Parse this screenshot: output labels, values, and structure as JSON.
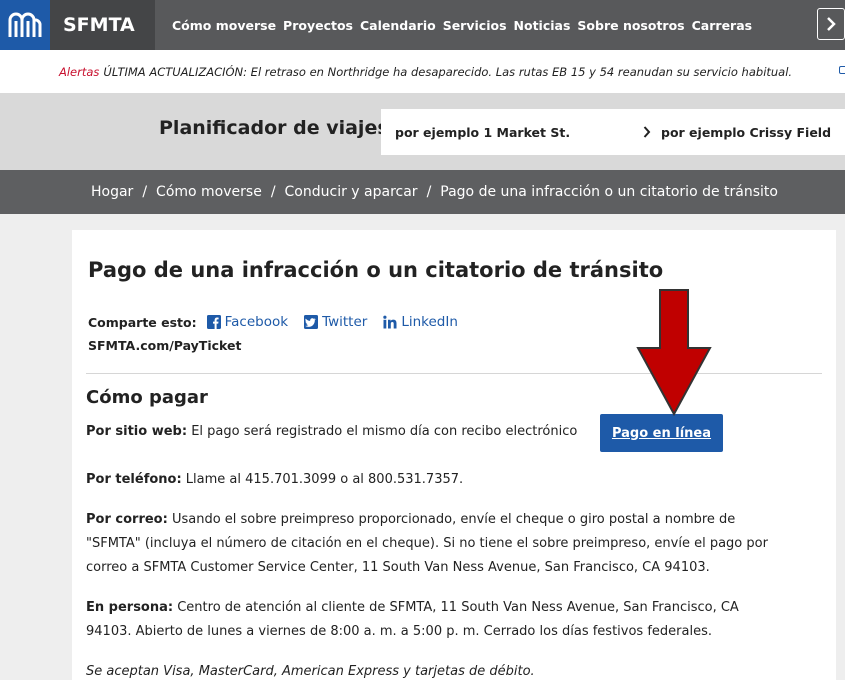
{
  "nav": {
    "brand": "SFMTA",
    "links": [
      "Cómo moverse",
      "Proyectos",
      "Calendario",
      "Servicios",
      "Noticias",
      "Sobre nosotros",
      "Carreras"
    ]
  },
  "alert": {
    "label": "Alertas",
    "text": "ÚLTIMA ACTUALIZACIÓN: El retraso en Northridge ha desaparecido. Las rutas EB 15 y 54 reanudan su servicio habitual."
  },
  "planner": {
    "title": "Planificador de viajes",
    "from_placeholder": "por ejemplo 1 Market St.",
    "to_placeholder": "por ejemplo Crissy Field"
  },
  "breadcrumb": [
    "Hogar",
    "Cómo moverse",
    "Conducir y aparcar",
    "Pago de una infracción o un citatorio de tránsito"
  ],
  "page": {
    "title": "Pago de una infracción o un citatorio de tránsito",
    "share_label": "Comparte esto:",
    "share_links": [
      "Facebook",
      "Twitter",
      "LinkedIn"
    ],
    "shortlink": "SFMTA.com/PayTicket",
    "section_title": "Cómo pagar",
    "web_label": "Por sitio web:",
    "web_text": " El pago será registrado el mismo día con recibo electrónico",
    "pay_button": "Pago en línea",
    "phone_label": "Por teléfono:",
    "phone_text": " Llame al 415.701.3099 o al 800.531.7357.",
    "mail_label": "Por correo:",
    "mail_text": " Usando el sobre preimpreso proporcionado, envíe el cheque o giro postal a nombre de \"SFMTA\" (incluya el número de citación en el cheque). Si no tiene el sobre preimpreso, envíe el pago por correo a SFMTA Customer Service Center, 11 South Van Ness Avenue, San Francisco, CA 94103.",
    "person_label": "En persona:",
    "person_text": " Centro de atención al cliente de SFMTA, 11 South Van Ness Avenue, San Francisco, CA 94103. Abierto de lunes a viernes de 8:00 a. m. a 5:00 p. m. Cerrado los días festivos federales.",
    "cards_text": "Se aceptan Visa, MasterCard, American Express y tarjetas de débito."
  },
  "colors": {
    "brand_blue": "#1e5aa8",
    "nav_gray": "#58595b",
    "alert_red": "#c8102e",
    "arrow_red": "#c00000"
  }
}
